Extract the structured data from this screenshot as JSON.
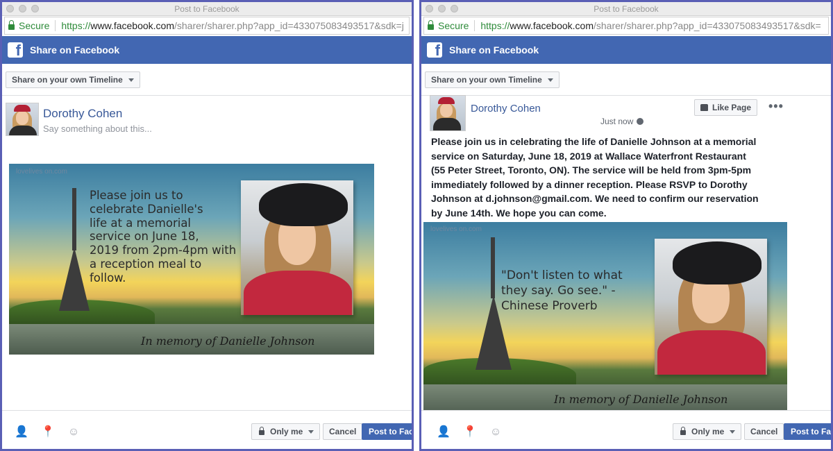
{
  "window": {
    "title": "Post to Facebook"
  },
  "urlbar": {
    "secure_label": "Secure",
    "url_proto": "https://",
    "url_host": "www.facebook.com",
    "url_rest_left": "/sharer/sharer.php?app_id=433075083493517&sdk=j",
    "url_rest_right": "/sharer/sharer.php?app_id=433075083493517&sdk="
  },
  "header": {
    "title": "Share on Facebook"
  },
  "share_target": {
    "label": "Share on your own Timeline"
  },
  "composer": {
    "user_name": "Dorothy Cohen",
    "placeholder": "Say something about this..."
  },
  "left_card": {
    "watermark": "lovelives on.com",
    "text_lines": [
      "Please join us to",
      "celebrate Danielle's",
      "life at a memorial",
      "service on June 18,",
      "2019 from 2pm-4pm with",
      "a reception meal to",
      "follow."
    ],
    "memory": "In memory of Danielle Johnson"
  },
  "right_post": {
    "user_name": "Dorothy Cohen",
    "timestamp": "Just now",
    "like_page_label": "Like Page",
    "more_label": "•••",
    "text_lines": [
      "Please join us in celebrating the life of Danielle Johnson at a memorial",
      "service on Saturday, June 18, 2019 at Wallace Waterfront Restaurant",
      "(55 Peter Street, Toronto, ON). The service will be held from 3pm-5pm",
      "immediately followed by a dinner reception. Please RSVP to Dorothy",
      "Johnson at d.johnson@gmail.com. We need to confirm our reservation",
      "by June 14th. We hope you can come."
    ],
    "card_watermark": "lovelives on.com",
    "quote_lines": [
      "\"Don't listen to what",
      "they say. Go see.\" -",
      "Chinese Proverb"
    ],
    "memory": "In memory of Danielle Johnson"
  },
  "footer": {
    "privacy_label": "Only me",
    "cancel_label": "Cancel",
    "post_label": "Post to Facebook"
  }
}
